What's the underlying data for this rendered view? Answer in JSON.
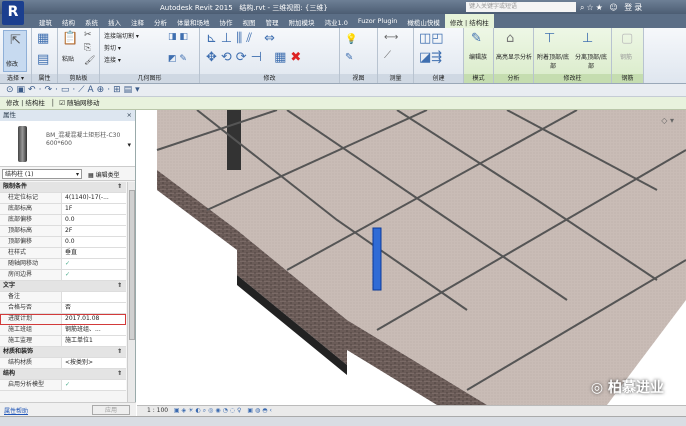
{
  "title": {
    "app": "Autodesk Revit 2015",
    "doc": "结构.rvt - 三维视图: {三维}",
    "search_placeholder": "键入关键字或短语",
    "login": "登录"
  },
  "tabs": [
    "建筑",
    "结构",
    "系统",
    "插入",
    "注释",
    "分析",
    "体量和场地",
    "协作",
    "视图",
    "管理",
    "附加模块",
    "鸿业1.0",
    "Fuzor Plugin",
    "橄榄山快模",
    "修改 | 结构柱"
  ],
  "ribbon": {
    "panels": [
      {
        "label": "选择 ▾",
        "buttons": [
          "修改"
        ]
      },
      {
        "label": "属性",
        "buttons": []
      },
      {
        "label": "剪贴板",
        "buttons": [
          "粘贴",
          "剪切 ▾",
          "连接 ▾"
        ]
      },
      {
        "label": "几何图形",
        "buttons": [
          "连接端切割 ▾"
        ]
      },
      {
        "label": "修改",
        "buttons": []
      },
      {
        "label": "视图",
        "buttons": []
      },
      {
        "label": "测量",
        "buttons": []
      },
      {
        "label": "创建",
        "buttons": []
      },
      {
        "label": "模式",
        "buttons": [
          "编辑族"
        ]
      },
      {
        "label": "分析",
        "buttons": [
          "高亮显示分析"
        ]
      },
      {
        "label": "修改柱",
        "buttons": [
          "附着顶部/底部",
          "分离顶部/底部"
        ]
      },
      {
        "label": "钢筋",
        "buttons": [
          "钢筋"
        ]
      }
    ]
  },
  "options_bar": {
    "context": "修改 | 结构柱",
    "move_with_grids": "随轴网移动"
  },
  "properties": {
    "title": "属性",
    "type_name": "BM_混凝混凝土矩形柱-C30",
    "type_size": "600*600",
    "selector": "结构柱 (1)",
    "edit_type": "编辑类型",
    "groups": [
      {
        "name": "限制条件",
        "rows": [
          [
            "柱定位标记",
            "4(1140)-17(-..."
          ],
          [
            "底部标高",
            "1F"
          ],
          [
            "底部偏移",
            "0.0"
          ],
          [
            "顶部标高",
            "2F"
          ],
          [
            "顶部偏移",
            "0.0"
          ],
          [
            "柱样式",
            "垂直"
          ],
          [
            "随轴网移动",
            "✓"
          ],
          [
            "房间边界",
            "✓"
          ]
        ]
      },
      {
        "name": "文字",
        "rows": [
          [
            "备注",
            ""
          ],
          [
            "合格与否",
            "否"
          ],
          [
            "进度计划",
            "2017.01.08"
          ],
          [
            "施工班组",
            "钢筋班组、..."
          ],
          [
            "施工监理",
            "施工单位1"
          ]
        ]
      },
      {
        "name": "材质和装饰",
        "rows": [
          [
            "结构材质",
            "<按类别>"
          ]
        ]
      },
      {
        "name": "结构",
        "rows": [
          [
            "启用分析模型",
            "✓"
          ]
        ]
      }
    ],
    "help": "属性帮助",
    "apply": "应用"
  },
  "view_control": {
    "scale": "1 : 100"
  },
  "watermark": "柏慕进业",
  "accent": "#d23a3a"
}
